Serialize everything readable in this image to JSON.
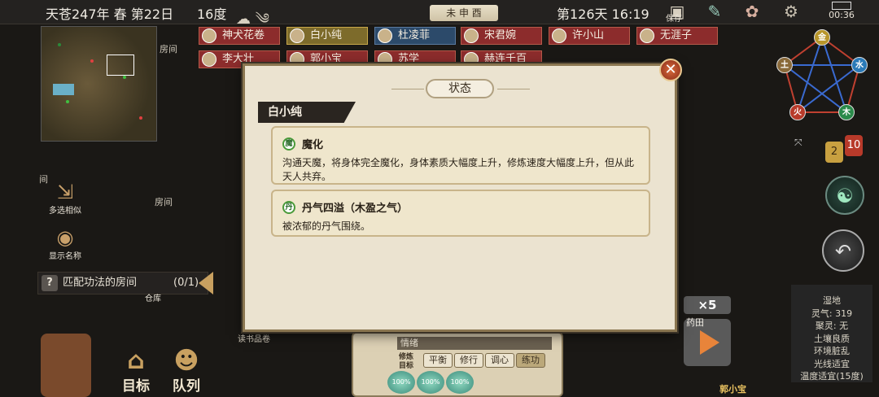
{
  "topbar": {
    "date": "天苍247年 春 第22日",
    "temperature": "16度",
    "shichen": "未 申 酉",
    "day": "第126天 16:19",
    "save_label": "保存",
    "clock": "00:36"
  },
  "map_labels": {
    "room_1": "房间",
    "room_2": "房间",
    "room_3": "房间",
    "room_4": "间",
    "room_5": "房间",
    "warehouse": "仓库",
    "scroll": "读书品卷"
  },
  "characters": [
    {
      "name": "神犬花卷",
      "style": "red"
    },
    {
      "name": "白小纯",
      "style": "gold"
    },
    {
      "name": "杜凌菲",
      "style": "blue"
    },
    {
      "name": "宋君婉",
      "style": "red"
    },
    {
      "name": "许小山",
      "style": "red"
    },
    {
      "name": "无涯子",
      "style": "red"
    },
    {
      "name": "李大壮",
      "style": "red"
    },
    {
      "name": "郭小宝",
      "style": "red"
    },
    {
      "name": "苏学",
      "style": "red"
    },
    {
      "name": "赫连千百",
      "style": "red"
    }
  ],
  "side_buttons": {
    "multi_select": "多选相似",
    "show_names": "显示名称"
  },
  "match_rooms": {
    "label": "匹配功法的房间",
    "count": "(0/1)"
  },
  "bottom_menu": {
    "target": "目标",
    "team": "队列"
  },
  "wuxing": {
    "metal": "金",
    "water": "水",
    "wood": "木",
    "fire": "火",
    "earth": "土"
  },
  "badges": {
    "left": "2",
    "right": "10"
  },
  "environment": {
    "terrain": "湿地",
    "lingqi": "灵气: 319",
    "juling": "聚灵: 无",
    "soil": "土壤良质",
    "env": "环境脏乱",
    "light": "光线适宜",
    "temp": "温度适宜(15度)"
  },
  "speed": {
    "label": "×5",
    "field": "药田"
  },
  "bottom_name": "郭小宝",
  "cultivation": {
    "mood": "情绪",
    "goal_label": "修炼目标",
    "options": [
      "平衡",
      "修行",
      "调心",
      "练功"
    ],
    "active": 3,
    "pcts": [
      "100%",
      "100%",
      "100%"
    ]
  },
  "dialog": {
    "title": "状态",
    "character": "白小纯",
    "watermark": "房间",
    "statuses": [
      {
        "icon": "魔",
        "name": "魔化",
        "desc": "沟通天魔，将身体完全魔化，身体素质大幅度上升，修炼速度大幅度上升，但从此天人共弃。"
      },
      {
        "icon": "丹",
        "name": "丹气四溢（木盈之气）",
        "desc": "被浓郁的丹气围绕。"
      }
    ]
  },
  "colors": {
    "dialog_bg": "#ebe3d0",
    "card_bg": "#efe6cc",
    "tag_red": "#8c2c2c",
    "accent_gold": "#c8a060"
  }
}
